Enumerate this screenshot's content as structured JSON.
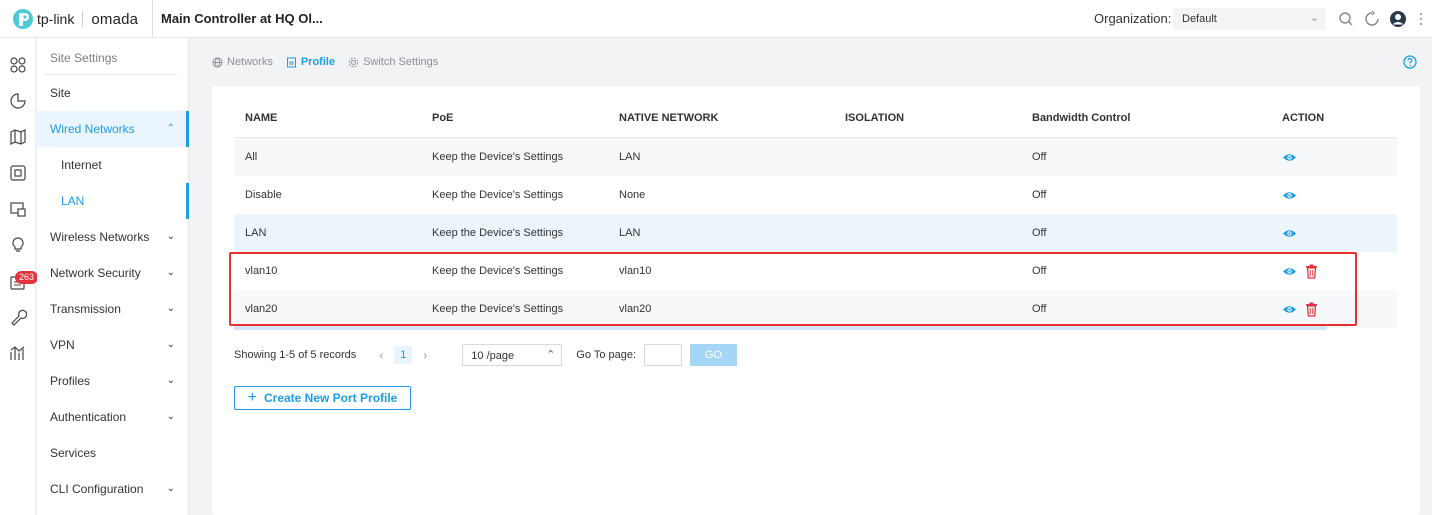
{
  "header": {
    "brand": "tp-link",
    "product": "omada",
    "controller_title": "Main Controller at HQ Ol...",
    "org_label": "Organization:",
    "org_value": "Default"
  },
  "rail": {
    "badge_count": "263",
    "icons": [
      "dashboard-icon",
      "statistics-icon",
      "map-icon",
      "devices-icon",
      "clients-icon",
      "insight-icon",
      "log-icon",
      "tools-icon",
      "reports-icon"
    ]
  },
  "sidebar": {
    "header": "Site Settings",
    "items": [
      {
        "label": "Site"
      },
      {
        "label": "Wired Networks"
      },
      {
        "label": "Internet"
      },
      {
        "label": "LAN"
      },
      {
        "label": "Wireless Networks"
      },
      {
        "label": "Network Security"
      },
      {
        "label": "Transmission"
      },
      {
        "label": "VPN"
      },
      {
        "label": "Profiles"
      },
      {
        "label": "Authentication"
      },
      {
        "label": "Services"
      },
      {
        "label": "CLI Configuration"
      }
    ]
  },
  "tabs": [
    {
      "label": "Networks"
    },
    {
      "label": "Profile"
    },
    {
      "label": "Switch Settings"
    }
  ],
  "table": {
    "columns": [
      "NAME",
      "PoE",
      "NATIVE NETWORK",
      "ISOLATION",
      "Bandwidth Control",
      "ACTION"
    ],
    "rows": [
      {
        "name": "All",
        "poe": "Keep the Device's Settings",
        "native": "LAN",
        "isolation": "",
        "bandwidth": "Off"
      },
      {
        "name": "Disable",
        "poe": "Keep the Device's Settings",
        "native": "None",
        "isolation": "",
        "bandwidth": "Off"
      },
      {
        "name": "LAN",
        "poe": "Keep the Device's Settings",
        "native": "LAN",
        "isolation": "",
        "bandwidth": "Off"
      },
      {
        "name": "vlan10",
        "poe": "Keep the Device's Settings",
        "native": "vlan10",
        "isolation": "",
        "bandwidth": "Off"
      },
      {
        "name": "vlan20",
        "poe": "Keep the Device's Settings",
        "native": "vlan20",
        "isolation": "",
        "bandwidth": "Off"
      }
    ]
  },
  "pagination": {
    "summary": "Showing 1-5 of 5 records",
    "current_page": "1",
    "page_size": "10 /page",
    "goto_label": "Go To page:",
    "goto_value": "",
    "go_button": "GO"
  },
  "create_button": "Create New Port Profile",
  "colors": {
    "accent": "#1a9ee5",
    "danger": "#e5333e",
    "highlight_box": "#e8312b"
  }
}
